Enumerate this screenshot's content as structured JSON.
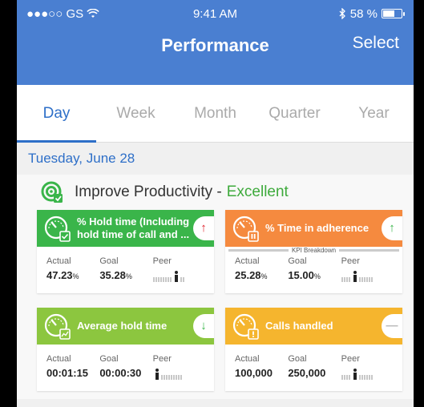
{
  "status_bar": {
    "carrier": "●●●○○ GS",
    "time": "9:41 AM",
    "battery_percent": "58 %"
  },
  "navbar": {
    "title": "Performance",
    "select_label": "Select"
  },
  "tabs": [
    {
      "label": "Day",
      "active": true
    },
    {
      "label": "Week",
      "active": false
    },
    {
      "label": "Month",
      "active": false
    },
    {
      "label": "Quarter",
      "active": false
    },
    {
      "label": "Year",
      "active": false
    }
  ],
  "date_label": "Tuesday, June 28",
  "goal": {
    "title": "Improve Productivity - ",
    "rating": "Excellent"
  },
  "kpi_breakdown_label": "KPI Breakdown",
  "cards": [
    {
      "title": "% Hold time (Including hold time of call and ...",
      "trend": "↑",
      "trend_color": "#e0242c",
      "color": "green",
      "actual_label": "Actual",
      "actual_value": "47.23",
      "actual_unit": "%",
      "goal_label": "Goal",
      "goal_value": "35.28",
      "goal_unit": "%",
      "peer_label": "Peer"
    },
    {
      "title": "% Time in adherence",
      "trend": "↑",
      "trend_color": "#3ab54a",
      "color": "orange",
      "actual_label": "Actual",
      "actual_value": "25.28",
      "actual_unit": "%",
      "goal_label": "Goal",
      "goal_value": "15.00",
      "goal_unit": "%",
      "peer_label": "Peer"
    },
    {
      "title": "Average hold time",
      "trend": "↓",
      "trend_color": "#3ab54a",
      "color": "lime",
      "actual_label": "Actual",
      "actual_value": "00:01:15",
      "actual_unit": "",
      "goal_label": "Goal",
      "goal_value": "00:00:30",
      "goal_unit": "",
      "peer_label": "Peer"
    },
    {
      "title": "Calls handled",
      "trend": "—",
      "trend_color": "#bbbbbb",
      "color": "yellow",
      "actual_label": "Actual",
      "actual_value": "100,000",
      "actual_unit": "",
      "goal_label": "Goal",
      "goal_value": "250,000",
      "goal_unit": "",
      "peer_label": "Peer"
    }
  ]
}
